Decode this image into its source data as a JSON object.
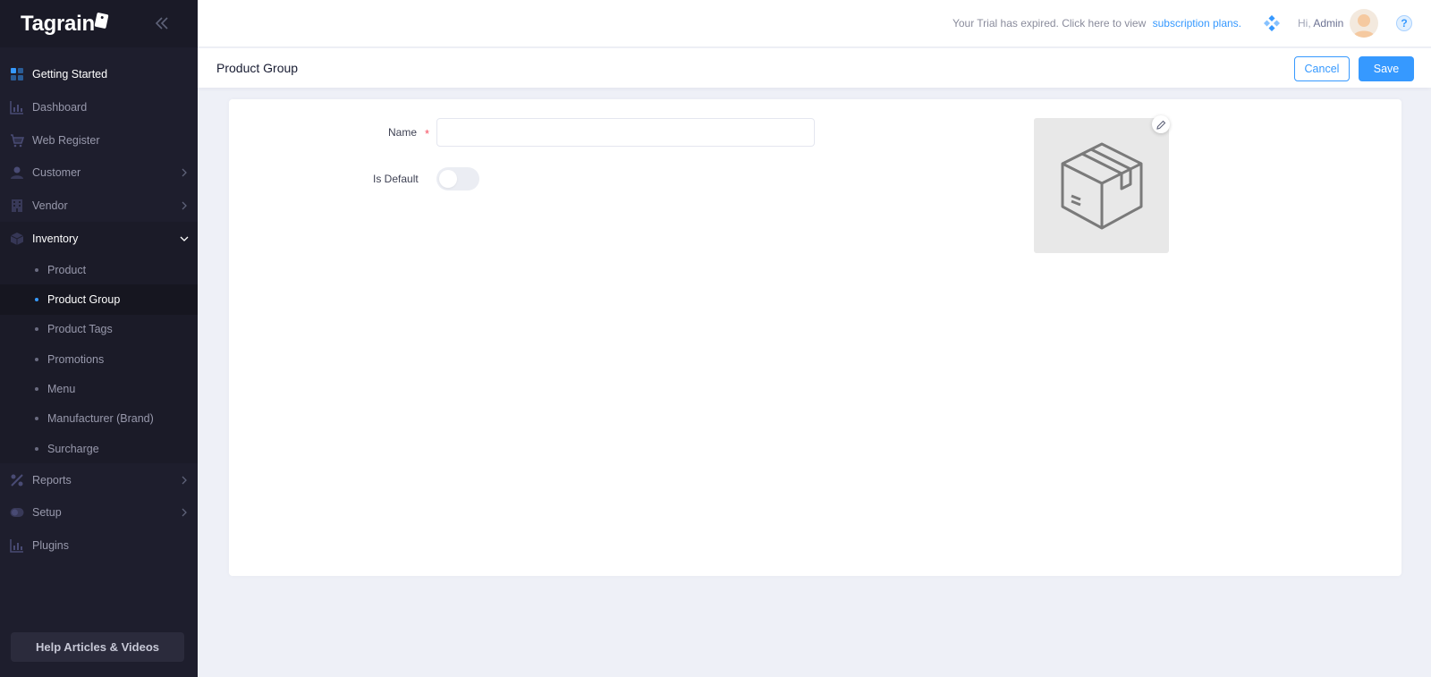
{
  "brand": {
    "name": "Tagrain"
  },
  "sidebar": {
    "items": [
      {
        "label": "Getting Started",
        "icon": "grid-icon"
      },
      {
        "label": "Dashboard",
        "icon": "bar-chart-icon"
      },
      {
        "label": "Web Register",
        "icon": "cart-icon"
      },
      {
        "label": "Customer",
        "icon": "user-icon"
      },
      {
        "label": "Vendor",
        "icon": "building-icon"
      },
      {
        "label": "Inventory",
        "icon": "box-icon"
      },
      {
        "label": "Reports",
        "icon": "percent-icon"
      },
      {
        "label": "Setup",
        "icon": "toggle-icon"
      },
      {
        "label": "Plugins",
        "icon": "bar-chart-icon"
      }
    ],
    "inventory_submenu": [
      {
        "label": "Product"
      },
      {
        "label": "Product Group"
      },
      {
        "label": "Product Tags"
      },
      {
        "label": "Promotions"
      },
      {
        "label": "Menu"
      },
      {
        "label": "Manufacturer (Brand)"
      },
      {
        "label": "Surcharge"
      }
    ],
    "help_label": "Help Articles & Videos"
  },
  "header": {
    "trial_text": "Your Trial has expired. Click here to view",
    "trial_link": "subscription plans.",
    "greeting": "Hi,",
    "user_name": "Admin",
    "help_mark": "?"
  },
  "page": {
    "title": "Product Group",
    "cancel_label": "Cancel",
    "save_label": "Save"
  },
  "form": {
    "name_label": "Name",
    "required_mark": "*",
    "name_value": "",
    "is_default_label": "Is Default",
    "is_default_on": false
  },
  "colors": {
    "accent": "#3699ff",
    "sidebar_bg": "#1e1e2d",
    "page_bg": "#eef0f7"
  }
}
